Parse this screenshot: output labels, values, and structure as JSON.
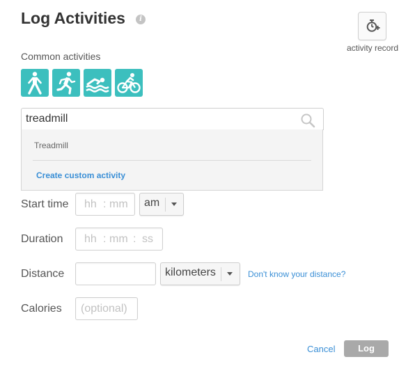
{
  "header": {
    "title": "Log Activities",
    "info_icon_glyph": "i"
  },
  "activity_record": {
    "label": "activity record",
    "icon": "stopwatch-plus-icon"
  },
  "common": {
    "label": "Common activities",
    "tiles": [
      {
        "name": "walk",
        "icon": "walking-icon"
      },
      {
        "name": "run",
        "icon": "running-icon"
      },
      {
        "name": "swim",
        "icon": "swimming-icon"
      },
      {
        "name": "bike",
        "icon": "cycling-icon"
      }
    ],
    "tile_color": "#3cbfbe"
  },
  "search": {
    "value": "treadmill",
    "icon": "search-icon"
  },
  "suggestions": {
    "items": [
      "Treadmill"
    ],
    "create_label": "Create custom activity"
  },
  "start_time": {
    "label": "Start time",
    "hh_placeholder": "hh",
    "colon": ":",
    "mm_placeholder": "mm",
    "ampm_value": "am"
  },
  "duration": {
    "label": "Duration",
    "hh_placeholder": "hh",
    "colon": ":",
    "mm_placeholder": "mm",
    "colon2": ":",
    "ss_placeholder": "ss"
  },
  "distance": {
    "label": "Distance",
    "value": "",
    "unit_value": "kilometers",
    "help_link": "Don't know your distance?"
  },
  "calories": {
    "label": "Calories",
    "placeholder": "(optional)"
  },
  "actions": {
    "cancel_label": "Cancel",
    "log_label": "Log"
  },
  "colors": {
    "link": "#3a8fd6",
    "log_button": "#a9a9a9"
  }
}
